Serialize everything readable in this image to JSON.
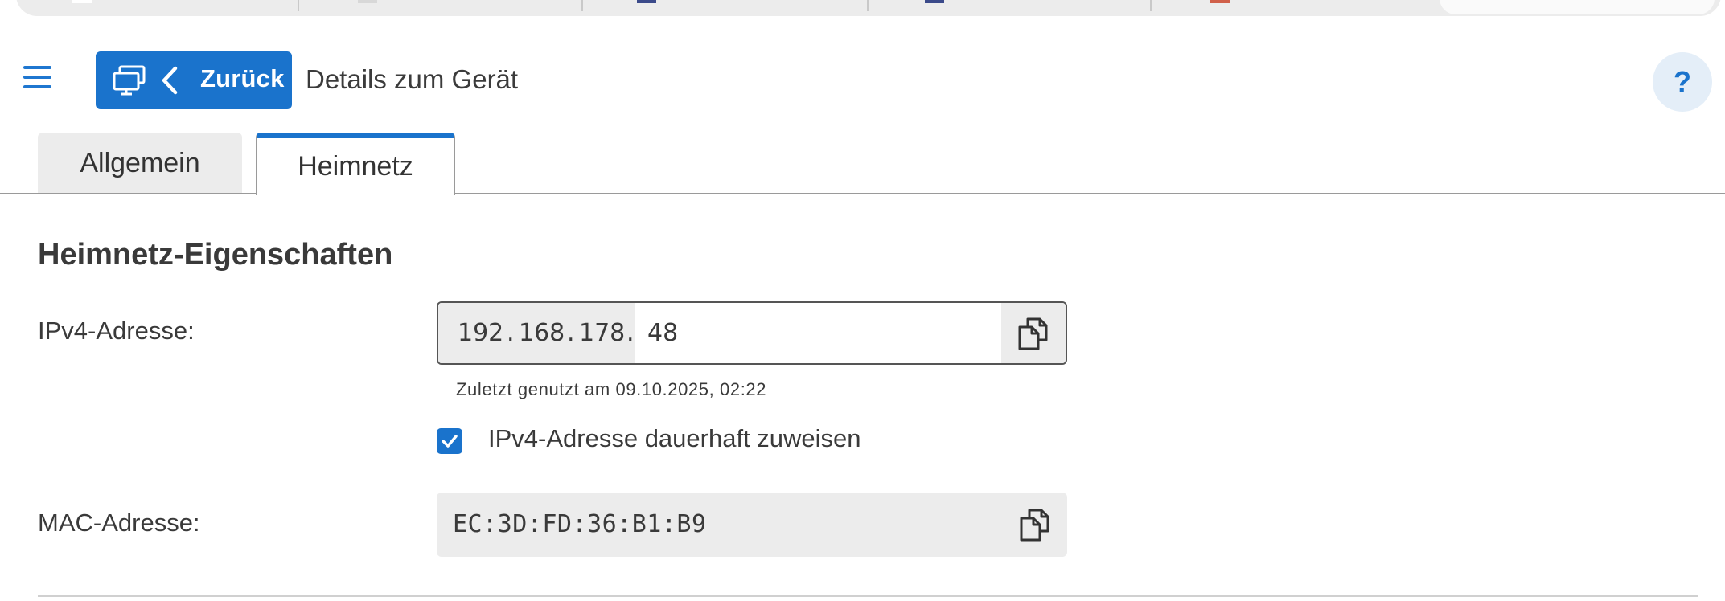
{
  "header": {
    "back_label": "Zurück",
    "page_title": "Details zum Gerät",
    "help_label": "?"
  },
  "tabs": [
    {
      "label": "Allgemein",
      "active": false
    },
    {
      "label": "Heimnetz",
      "active": true
    }
  ],
  "section": {
    "title": "Heimnetz-Eigenschaften"
  },
  "ipv4": {
    "label": "IPv4-Adresse:",
    "segments": [
      "192",
      "168",
      "178"
    ],
    "value": "48",
    "last_used": "Zuletzt genutzt am 09.10.2025, 02:22"
  },
  "assign": {
    "label": "IPv4-Adresse dauerhaft zuweisen",
    "checked": true
  },
  "mac": {
    "label": "MAC-Adresse:",
    "value": "EC:3D:FD:36:B1:B9"
  },
  "colors": {
    "accent": "#1a73cc",
    "tab_inactive_bg": "#ececec",
    "help_bg": "#e4eef8"
  },
  "icons": {
    "menu": "hamburger-icon",
    "device": "monitor-icon",
    "back": "chevron-left-icon",
    "copy": "copy-icon",
    "check": "checkmark-icon"
  }
}
